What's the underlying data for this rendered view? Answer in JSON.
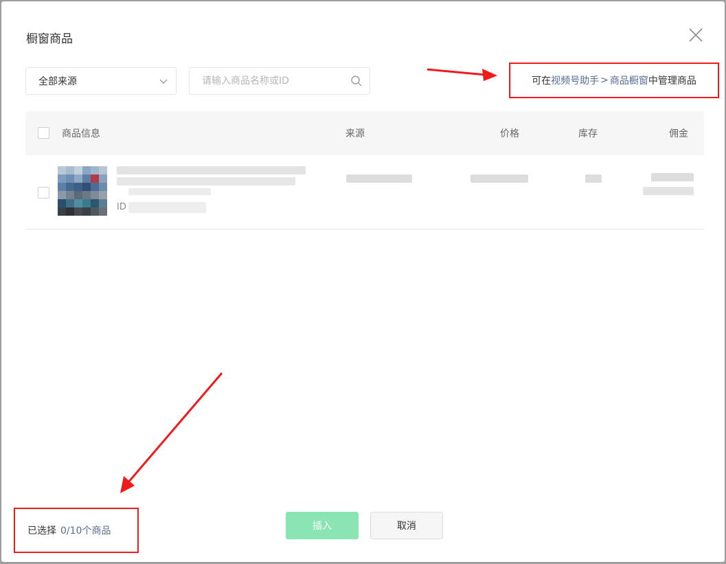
{
  "dialog": {
    "title": "橱窗商品"
  },
  "toolbar": {
    "source_select": {
      "selected": "全部来源"
    },
    "search": {
      "placeholder": "请输入商品名称或ID"
    }
  },
  "manage_hint": {
    "prefix": "可在",
    "link1": "视频号助手",
    "separator": ">",
    "link2": "商品橱窗",
    "suffix": "中管理商品"
  },
  "table": {
    "columns": [
      "商品信息",
      "来源",
      "价格",
      "库存",
      "佣金"
    ],
    "rows": [
      {
        "id_label": "ID"
      }
    ]
  },
  "footer": {
    "selected_prefix": "已选择",
    "selected_count": "0/10个商品",
    "insert_label": "插入",
    "cancel_label": "取消"
  },
  "colors": {
    "annotation_red": "#ef1b1b",
    "link": "#576b95",
    "insert_button": "#8be4b3"
  }
}
